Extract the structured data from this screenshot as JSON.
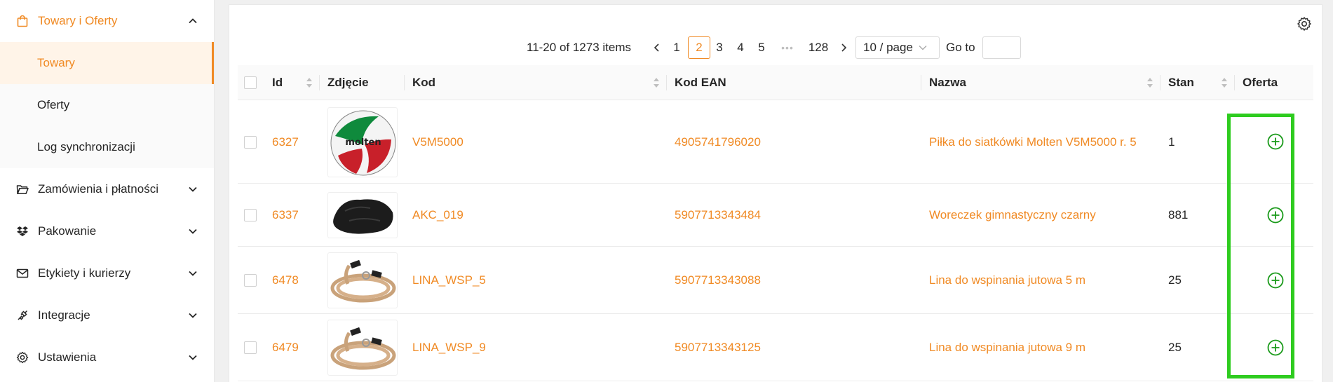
{
  "sidebar": {
    "groups": [
      {
        "label": "Towary i Oferty",
        "icon": "shopping-bag-icon",
        "expanded": true
      },
      {
        "label": "Zamówienia i płatności",
        "icon": "folder-open-icon"
      },
      {
        "label": "Pakowanie",
        "icon": "dropbox-icon"
      },
      {
        "label": "Etykiety i kurierzy",
        "icon": "mail-icon"
      },
      {
        "label": "Integracje",
        "icon": "plug-icon"
      },
      {
        "label": "Ustawienia",
        "icon": "gear-icon"
      }
    ],
    "sub_items": [
      {
        "label": "Towary",
        "selected": true
      },
      {
        "label": "Oferty"
      },
      {
        "label": "Log synchronizacji"
      }
    ]
  },
  "pagination": {
    "summary": "11-20 of 1273 items",
    "pages": [
      "1",
      "2",
      "3",
      "4",
      "5"
    ],
    "current_page": "2",
    "ellipsis": "•••",
    "last_page": "128",
    "page_size": "10 / page",
    "goto_label": "Go to"
  },
  "table": {
    "columns": {
      "id": "Id",
      "photo": "Zdjęcie",
      "code": "Kod",
      "ean": "Kod EAN",
      "name": "Nazwa",
      "stock": "Stan",
      "offer": "Oferta"
    },
    "rows": [
      {
        "id": "6327",
        "code": "V5M5000",
        "ean": "4905741796020",
        "name": "Piłka do siatkówki Molten V5M5000 r. 5",
        "stock": "1",
        "photo": "volleyball"
      },
      {
        "id": "6337",
        "code": "AKC_019",
        "ean": "5907713343484",
        "name": "Woreczek gimnastyczny czarny",
        "stock": "881",
        "photo": "bean-bag"
      },
      {
        "id": "6478",
        "code": "LINA_WSP_5",
        "ean": "5907713343088",
        "name": "Lina do wspinania jutowa 5 m",
        "stock": "25",
        "photo": "rope"
      },
      {
        "id": "6479",
        "code": "LINA_WSP_9",
        "ean": "5907713343125",
        "name": "Lina do wspinania jutowa 9 m",
        "stock": "25",
        "photo": "rope"
      }
    ]
  },
  "colors": {
    "accent": "#f08a24",
    "add_green": "#1a9a1a",
    "highlight": "#2ecc1f"
  }
}
